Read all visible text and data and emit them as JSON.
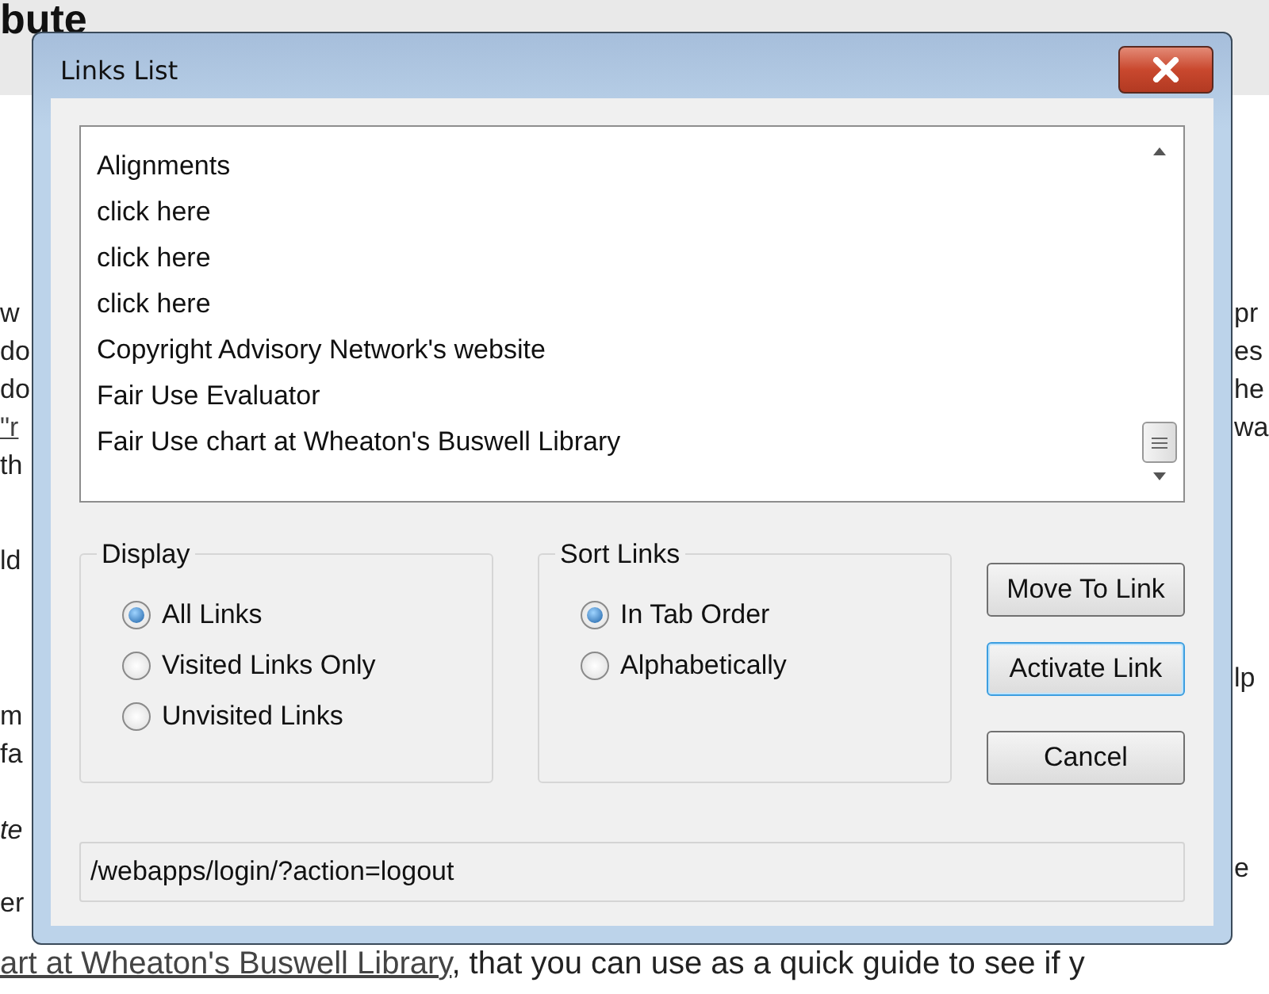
{
  "page": {
    "heading": "bute",
    "left_fragments": [
      {
        "text": "w",
        "kind": "text"
      },
      {
        "text": "do",
        "kind": "text"
      },
      {
        "text": "do",
        "kind": "text"
      },
      {
        "text": "\"r",
        "kind": "link"
      },
      {
        "text": "th",
        "kind": "text"
      },
      {
        "text": "ld",
        "kind": "text"
      },
      {
        "text": "m",
        "kind": "text"
      },
      {
        "text": "fa",
        "kind": "text"
      },
      {
        "text": "te",
        "kind": "italic"
      },
      {
        "text": "er",
        "kind": "text"
      }
    ],
    "right_fragments": [
      "pr",
      "es",
      "he",
      "wa",
      "lp",
      "e"
    ],
    "bottom_line": {
      "link": "art  at Wheaton's Buswell Library",
      "rest": ", that you can use as a quick guide to see if y"
    }
  },
  "dialog": {
    "title": "Links List",
    "links": [
      "Alignments",
      "click here",
      "click here",
      "click here",
      "Copyright Advisory Network's website",
      "Fair Use Evaluator",
      "Fair Use chart  at Wheaton's Buswell  Library"
    ],
    "display": {
      "label": "Display",
      "options": [
        {
          "label": "All Links",
          "selected": true
        },
        {
          "label": "Visited Links Only",
          "selected": false
        },
        {
          "label": "Unvisited Links",
          "selected": false
        }
      ]
    },
    "sort": {
      "label": "Sort Links",
      "options": [
        {
          "label": "In Tab Order",
          "selected": true
        },
        {
          "label": "Alphabetically",
          "selected": false
        }
      ]
    },
    "buttons": [
      {
        "label": "Move To Link",
        "focused": false
      },
      {
        "label": "Activate Link",
        "focused": true
      },
      {
        "label": "Cancel",
        "focused": false
      }
    ],
    "address": "/webapps/login/?action=logout"
  }
}
